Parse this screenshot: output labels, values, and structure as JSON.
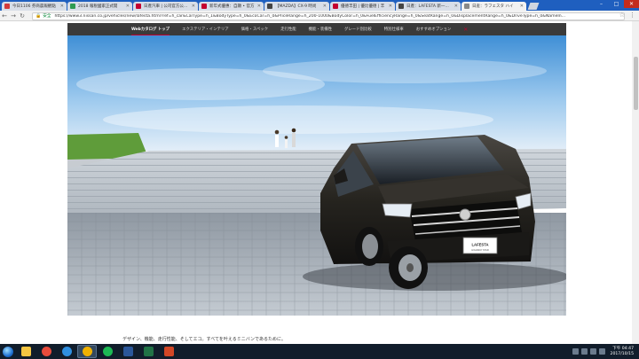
{
  "browser": {
    "tabs": [
      {
        "label": "今日1106 券商晨報觀點",
        "color": "#d23a3a"
      },
      {
        "label": "2018 報稅國家正式開",
        "color": "#2e9b52"
      },
      {
        "label": "日產汽車 | 公司官方公司 LA",
        "color": "#c3002f"
      },
      {
        "label": "新年式優惠：自顯 • 官方",
        "color": "#c3002f"
      },
      {
        "label": "【MAZDA】CX-9 時尚",
        "color": "#444444"
      },
      {
        "label": "優德丰田 | 優比優德 | 丰",
        "color": "#c3002f"
      },
      {
        "label": "日產：LAFESTA 新一代 国",
        "color": "#444444"
      },
      {
        "label": "日産：ラフェスタ ハイ",
        "color": "#888888"
      }
    ],
    "active_tab": 7,
    "secure_label": "安全",
    "url": "https://www3.nissan.co.jp/vehicles/new/lafesta.html?ref=h_car&CarType=h_1&BodyType=h_0&EcoCar=h_0&PriceRange=h_200-1000&BodyColor=h_0&FuelEfficiencyRange=h_0&SeatRange=h_0&DisplacementRange=h_0&DriveType=h_0&NameIn..."
  },
  "site_nav": {
    "items": [
      "Webカタログ トップ",
      "エクステリア・インテリア",
      "価格・スペック",
      "走行性能",
      "機能・装備性",
      "グレード別比較",
      "特別仕様車",
      "おすすめオプション"
    ],
    "active": 0,
    "close_glyph": "✕"
  },
  "hero": {
    "badge_text": "LAFESTA",
    "badge_subtext": "HIGHWAY STAR"
  },
  "caption": "デザイン、機能、走行性能、そしてエコ。すべてを叶えるミニバンであるために。",
  "taskbar": {
    "apps": [
      {
        "name": "explorer",
        "color": "#f4c542"
      },
      {
        "name": "media",
        "color": "#e84b3c"
      },
      {
        "name": "chrome-alt",
        "color": "#2f8fe0"
      },
      {
        "name": "chrome",
        "color": "#f0b100"
      },
      {
        "name": "spotify",
        "color": "#1db954"
      },
      {
        "name": "word",
        "color": "#2b579a"
      },
      {
        "name": "excel",
        "color": "#217346"
      },
      {
        "name": "powerpoint",
        "color": "#d24726"
      }
    ],
    "active_app": 3,
    "time": "下午 04:47",
    "date": "2017/10/15"
  }
}
